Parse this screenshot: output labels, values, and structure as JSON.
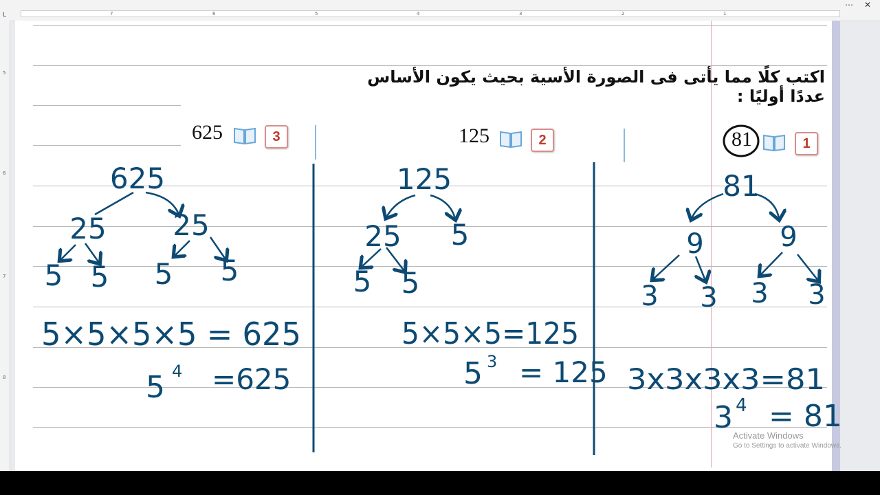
{
  "ruler": {
    "numbers": [
      "7",
      "6",
      "5",
      "4",
      "3",
      "2",
      "1"
    ],
    "tab_stop": "L"
  },
  "window_controls": {
    "more_icon": "⋯",
    "close_icon": "✕"
  },
  "vertical_ruler": {
    "numbers": [
      "5",
      "6",
      "7",
      "8"
    ]
  },
  "heading": "اكتب كلًا مما يأتى فى الصورة الأسية بحيث يكون الأساس عددًا أوليًا :",
  "problems": [
    {
      "badge": "1",
      "number": "81"
    },
    {
      "badge": "2",
      "number": "125"
    },
    {
      "badge": "3",
      "number": "625"
    }
  ],
  "handwriting": {
    "p1": {
      "root": "81",
      "level1": [
        "9",
        "9"
      ],
      "leaves": [
        "3",
        "3",
        "3",
        "3"
      ],
      "product": "3x3x3x3=81",
      "power_base": "3",
      "power_exp": "4",
      "power_rhs": "= 81"
    },
    "p2": {
      "root": "125",
      "level1": [
        "25",
        "5"
      ],
      "leaves": [
        "5",
        "5"
      ],
      "product": "5×5×5=125",
      "power_base": "5",
      "power_exp": "3",
      "power_rhs": "= 125"
    },
    "p3": {
      "root": "625",
      "level1": [
        "25",
        "25"
      ],
      "leaves": [
        "5",
        "5",
        "5",
        "5"
      ],
      "product": "5×5×5×5 = 625",
      "power_base": "5",
      "power_exp": "4",
      "power_rhs": "=625"
    }
  },
  "watermark": {
    "line1": "Activate Windows",
    "line2": "Go to Settings to activate Windows."
  },
  "colors": {
    "ink": "#0d4a73",
    "badge_red": "#c0392b",
    "margin_pink": "#e8a4b5",
    "book_blue": "#6aa7d8"
  }
}
